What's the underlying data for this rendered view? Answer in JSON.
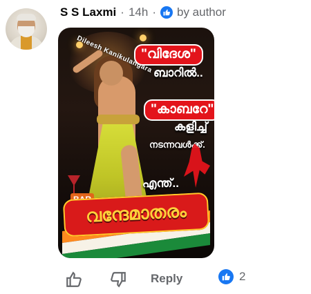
{
  "comment": {
    "author": "S S Laxmi",
    "separator": "·",
    "time": "14h",
    "by_author": "by author"
  },
  "meme": {
    "watermark": "Dileesh Kanikulangara",
    "line1": "\"വിദേശ\"",
    "line2": "ബാറിൽ..",
    "line3": "\"കാബറേ\"",
    "line4": "കളിച്ച്",
    "line5": "നടന്നവൾക്ക്.",
    "line6": "എന്ത്..",
    "bar": "BAR",
    "headline": "വന്ദേമാതരം"
  },
  "actions": {
    "reply": "Reply",
    "likes": "2"
  },
  "colors": {
    "accent": "#1877f2",
    "meta": "#65676b",
    "red": "#e3141b"
  }
}
